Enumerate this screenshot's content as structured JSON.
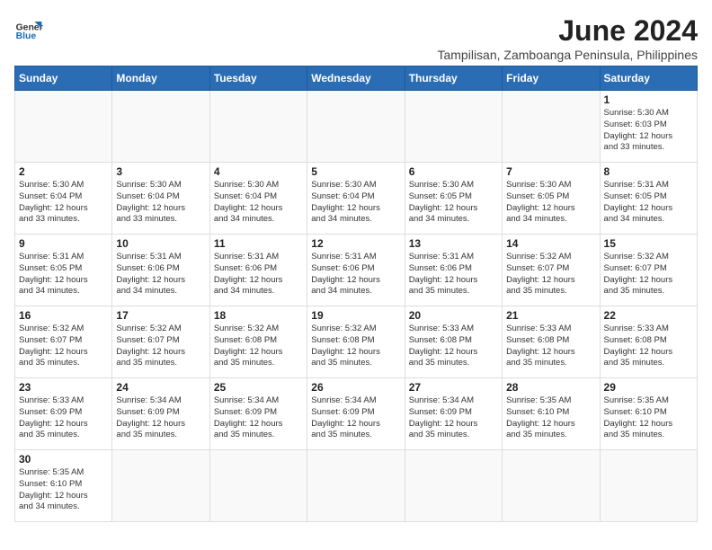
{
  "logo": {
    "text_general": "General",
    "text_blue": "Blue"
  },
  "header": {
    "month_year": "June 2024",
    "location": "Tampilisan, Zamboanga Peninsula, Philippines"
  },
  "weekdays": [
    "Sunday",
    "Monday",
    "Tuesday",
    "Wednesday",
    "Thursday",
    "Friday",
    "Saturday"
  ],
  "weeks": [
    [
      {
        "day": "",
        "info": ""
      },
      {
        "day": "",
        "info": ""
      },
      {
        "day": "",
        "info": ""
      },
      {
        "day": "",
        "info": ""
      },
      {
        "day": "",
        "info": ""
      },
      {
        "day": "",
        "info": ""
      },
      {
        "day": "1",
        "info": "Sunrise: 5:30 AM\nSunset: 6:03 PM\nDaylight: 12 hours\nand 33 minutes."
      }
    ],
    [
      {
        "day": "2",
        "info": "Sunrise: 5:30 AM\nSunset: 6:04 PM\nDaylight: 12 hours\nand 33 minutes."
      },
      {
        "day": "3",
        "info": "Sunrise: 5:30 AM\nSunset: 6:04 PM\nDaylight: 12 hours\nand 33 minutes."
      },
      {
        "day": "4",
        "info": "Sunrise: 5:30 AM\nSunset: 6:04 PM\nDaylight: 12 hours\nand 34 minutes."
      },
      {
        "day": "5",
        "info": "Sunrise: 5:30 AM\nSunset: 6:04 PM\nDaylight: 12 hours\nand 34 minutes."
      },
      {
        "day": "6",
        "info": "Sunrise: 5:30 AM\nSunset: 6:05 PM\nDaylight: 12 hours\nand 34 minutes."
      },
      {
        "day": "7",
        "info": "Sunrise: 5:30 AM\nSunset: 6:05 PM\nDaylight: 12 hours\nand 34 minutes."
      },
      {
        "day": "8",
        "info": "Sunrise: 5:31 AM\nSunset: 6:05 PM\nDaylight: 12 hours\nand 34 minutes."
      }
    ],
    [
      {
        "day": "9",
        "info": "Sunrise: 5:31 AM\nSunset: 6:05 PM\nDaylight: 12 hours\nand 34 minutes."
      },
      {
        "day": "10",
        "info": "Sunrise: 5:31 AM\nSunset: 6:06 PM\nDaylight: 12 hours\nand 34 minutes."
      },
      {
        "day": "11",
        "info": "Sunrise: 5:31 AM\nSunset: 6:06 PM\nDaylight: 12 hours\nand 34 minutes."
      },
      {
        "day": "12",
        "info": "Sunrise: 5:31 AM\nSunset: 6:06 PM\nDaylight: 12 hours\nand 34 minutes."
      },
      {
        "day": "13",
        "info": "Sunrise: 5:31 AM\nSunset: 6:06 PM\nDaylight: 12 hours\nand 35 minutes."
      },
      {
        "day": "14",
        "info": "Sunrise: 5:32 AM\nSunset: 6:07 PM\nDaylight: 12 hours\nand 35 minutes."
      },
      {
        "day": "15",
        "info": "Sunrise: 5:32 AM\nSunset: 6:07 PM\nDaylight: 12 hours\nand 35 minutes."
      }
    ],
    [
      {
        "day": "16",
        "info": "Sunrise: 5:32 AM\nSunset: 6:07 PM\nDaylight: 12 hours\nand 35 minutes."
      },
      {
        "day": "17",
        "info": "Sunrise: 5:32 AM\nSunset: 6:07 PM\nDaylight: 12 hours\nand 35 minutes."
      },
      {
        "day": "18",
        "info": "Sunrise: 5:32 AM\nSunset: 6:08 PM\nDaylight: 12 hours\nand 35 minutes."
      },
      {
        "day": "19",
        "info": "Sunrise: 5:32 AM\nSunset: 6:08 PM\nDaylight: 12 hours\nand 35 minutes."
      },
      {
        "day": "20",
        "info": "Sunrise: 5:33 AM\nSunset: 6:08 PM\nDaylight: 12 hours\nand 35 minutes."
      },
      {
        "day": "21",
        "info": "Sunrise: 5:33 AM\nSunset: 6:08 PM\nDaylight: 12 hours\nand 35 minutes."
      },
      {
        "day": "22",
        "info": "Sunrise: 5:33 AM\nSunset: 6:08 PM\nDaylight: 12 hours\nand 35 minutes."
      }
    ],
    [
      {
        "day": "23",
        "info": "Sunrise: 5:33 AM\nSunset: 6:09 PM\nDaylight: 12 hours\nand 35 minutes."
      },
      {
        "day": "24",
        "info": "Sunrise: 5:34 AM\nSunset: 6:09 PM\nDaylight: 12 hours\nand 35 minutes."
      },
      {
        "day": "25",
        "info": "Sunrise: 5:34 AM\nSunset: 6:09 PM\nDaylight: 12 hours\nand 35 minutes."
      },
      {
        "day": "26",
        "info": "Sunrise: 5:34 AM\nSunset: 6:09 PM\nDaylight: 12 hours\nand 35 minutes."
      },
      {
        "day": "27",
        "info": "Sunrise: 5:34 AM\nSunset: 6:09 PM\nDaylight: 12 hours\nand 35 minutes."
      },
      {
        "day": "28",
        "info": "Sunrise: 5:35 AM\nSunset: 6:10 PM\nDaylight: 12 hours\nand 35 minutes."
      },
      {
        "day": "29",
        "info": "Sunrise: 5:35 AM\nSunset: 6:10 PM\nDaylight: 12 hours\nand 35 minutes."
      }
    ],
    [
      {
        "day": "30",
        "info": "Sunrise: 5:35 AM\nSunset: 6:10 PM\nDaylight: 12 hours\nand 34 minutes."
      },
      {
        "day": "",
        "info": ""
      },
      {
        "day": "",
        "info": ""
      },
      {
        "day": "",
        "info": ""
      },
      {
        "day": "",
        "info": ""
      },
      {
        "day": "",
        "info": ""
      },
      {
        "day": "",
        "info": ""
      }
    ]
  ]
}
